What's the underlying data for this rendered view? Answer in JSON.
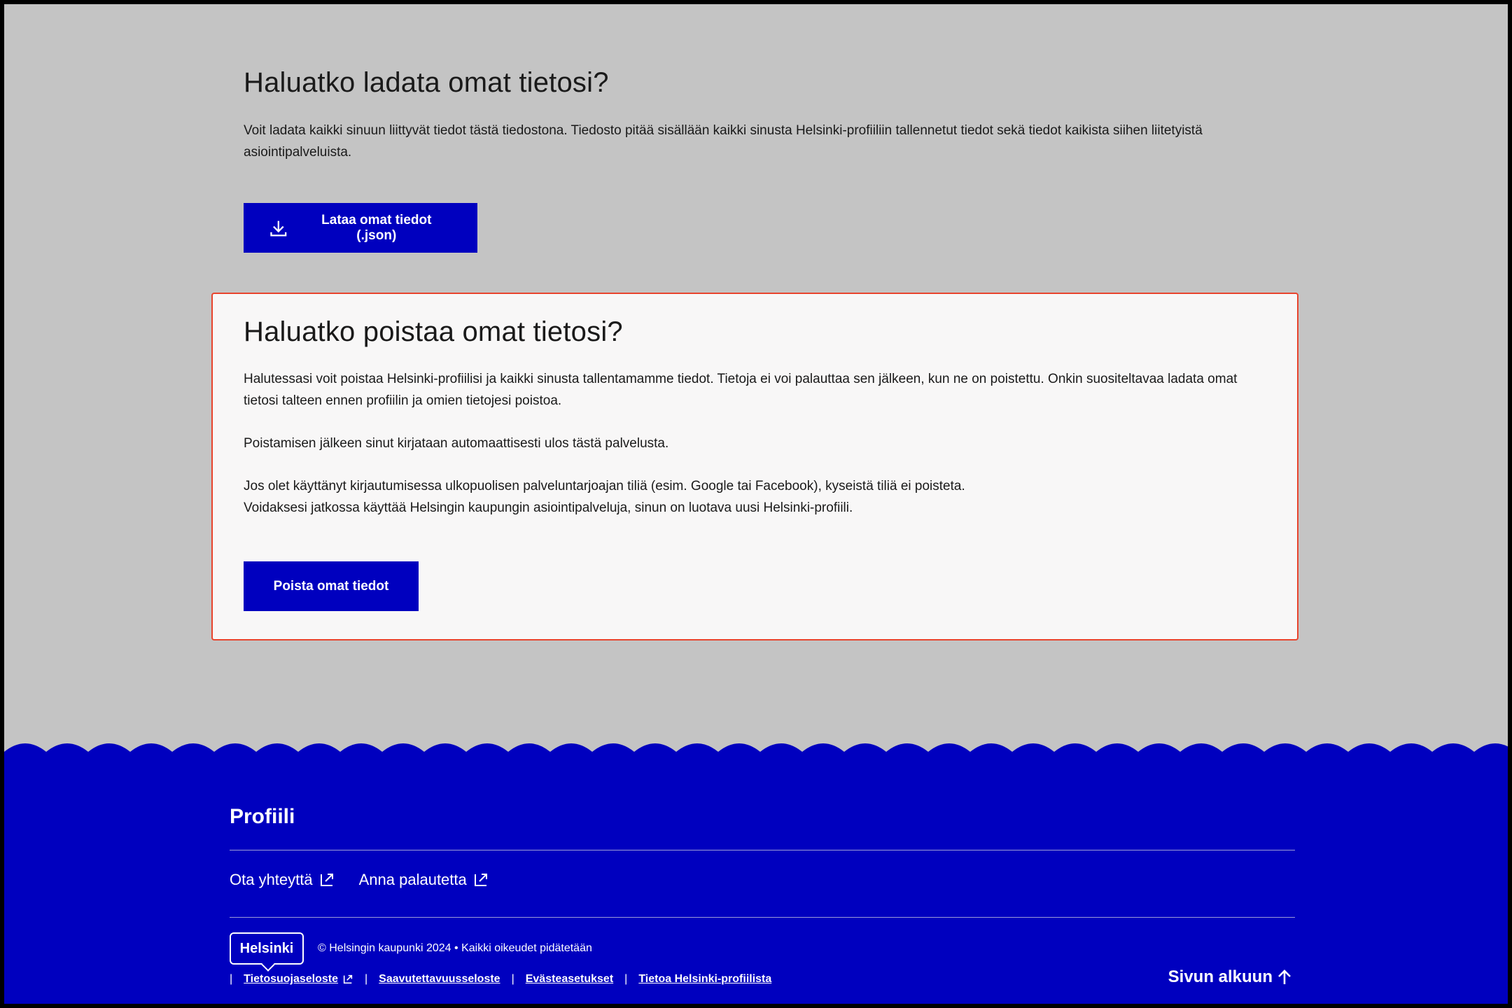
{
  "download": {
    "title": "Haluatko ladata omat tietosi?",
    "description": "Voit ladata kaikki sinuun liittyvät tiedot tästä tiedostona. Tiedosto pitää sisällään kaikki sinusta Helsinki-profiiliin tallennetut tiedot sekä tiedot kaikista siihen liitetyistä asiointipalveluista.",
    "button_label": "Lataa omat tiedot (.json)",
    "button_icon": "download-icon"
  },
  "delete": {
    "title": "Haluatko poistaa omat tietosi?",
    "paragraph_1": "Halutessasi voit poistaa Helsinki-profiilisi ja kaikki sinusta tallentamamme tiedot. Tietoja ei voi palauttaa sen jälkeen, kun ne on poistettu. Onkin suositeltavaa ladata omat tietosi talteen ennen profiilin ja omien tietojesi poistoa.",
    "paragraph_2": "Poistamisen jälkeen sinut kirjataan automaattisesti ulos tästä palvelusta.",
    "paragraph_3_line_1": "Jos olet käyttänyt kirjautumisessa ulkopuolisen palveluntarjoajan tiliä (esim. Google tai Facebook), kyseistä tiliä ei poisteta.",
    "paragraph_3_line_2": "Voidaksesi jatkossa käyttää Helsingin kaupungin asiointipalveluja, sinun on luotava uusi Helsinki-profiili.",
    "button_label": "Poista omat tiedot",
    "border_color": "#e8442d"
  },
  "footer": {
    "title": "Profiili",
    "links": [
      {
        "label": "Ota yhteyttä",
        "icon": "external-link-icon"
      },
      {
        "label": "Anna palautetta",
        "icon": "external-link-icon"
      }
    ],
    "logo_text": "Helsinki",
    "copyright": "© Helsingin kaupunki 2024 • Kaikki oikeudet pidätetään",
    "legal_links": [
      {
        "label": "Tietosuojaseloste",
        "icon": "external-link-icon"
      },
      {
        "label": "Saavutettavuusseloste"
      },
      {
        "label": "Evästeasetukset"
      },
      {
        "label": "Tietoa Helsinki-profiilista"
      }
    ],
    "back_to_top": "Sivun alkuun",
    "back_to_top_icon": "arrow-up-icon"
  },
  "colors": {
    "background": "#c4c4c4",
    "brand_blue": "#0000bf",
    "card_background": "#f8f7f7",
    "text": "#1a1a1a"
  }
}
